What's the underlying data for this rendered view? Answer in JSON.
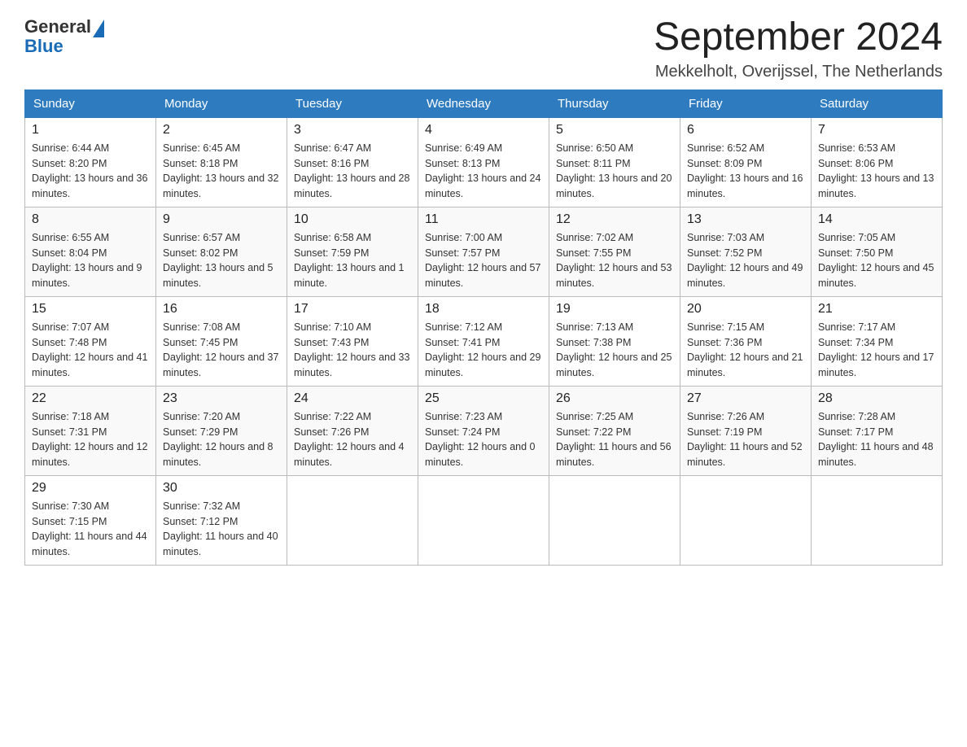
{
  "header": {
    "logo_general": "General",
    "logo_blue": "Blue",
    "title": "September 2024",
    "subtitle": "Mekkelholt, Overijssel, The Netherlands"
  },
  "weekdays": [
    "Sunday",
    "Monday",
    "Tuesday",
    "Wednesday",
    "Thursday",
    "Friday",
    "Saturday"
  ],
  "weeks": [
    [
      {
        "day": "1",
        "sunrise": "6:44 AM",
        "sunset": "8:20 PM",
        "daylight": "13 hours and 36 minutes."
      },
      {
        "day": "2",
        "sunrise": "6:45 AM",
        "sunset": "8:18 PM",
        "daylight": "13 hours and 32 minutes."
      },
      {
        "day": "3",
        "sunrise": "6:47 AM",
        "sunset": "8:16 PM",
        "daylight": "13 hours and 28 minutes."
      },
      {
        "day": "4",
        "sunrise": "6:49 AM",
        "sunset": "8:13 PM",
        "daylight": "13 hours and 24 minutes."
      },
      {
        "day": "5",
        "sunrise": "6:50 AM",
        "sunset": "8:11 PM",
        "daylight": "13 hours and 20 minutes."
      },
      {
        "day": "6",
        "sunrise": "6:52 AM",
        "sunset": "8:09 PM",
        "daylight": "13 hours and 16 minutes."
      },
      {
        "day": "7",
        "sunrise": "6:53 AM",
        "sunset": "8:06 PM",
        "daylight": "13 hours and 13 minutes."
      }
    ],
    [
      {
        "day": "8",
        "sunrise": "6:55 AM",
        "sunset": "8:04 PM",
        "daylight": "13 hours and 9 minutes."
      },
      {
        "day": "9",
        "sunrise": "6:57 AM",
        "sunset": "8:02 PM",
        "daylight": "13 hours and 5 minutes."
      },
      {
        "day": "10",
        "sunrise": "6:58 AM",
        "sunset": "7:59 PM",
        "daylight": "13 hours and 1 minute."
      },
      {
        "day": "11",
        "sunrise": "7:00 AM",
        "sunset": "7:57 PM",
        "daylight": "12 hours and 57 minutes."
      },
      {
        "day": "12",
        "sunrise": "7:02 AM",
        "sunset": "7:55 PM",
        "daylight": "12 hours and 53 minutes."
      },
      {
        "day": "13",
        "sunrise": "7:03 AM",
        "sunset": "7:52 PM",
        "daylight": "12 hours and 49 minutes."
      },
      {
        "day": "14",
        "sunrise": "7:05 AM",
        "sunset": "7:50 PM",
        "daylight": "12 hours and 45 minutes."
      }
    ],
    [
      {
        "day": "15",
        "sunrise": "7:07 AM",
        "sunset": "7:48 PM",
        "daylight": "12 hours and 41 minutes."
      },
      {
        "day": "16",
        "sunrise": "7:08 AM",
        "sunset": "7:45 PM",
        "daylight": "12 hours and 37 minutes."
      },
      {
        "day": "17",
        "sunrise": "7:10 AM",
        "sunset": "7:43 PM",
        "daylight": "12 hours and 33 minutes."
      },
      {
        "day": "18",
        "sunrise": "7:12 AM",
        "sunset": "7:41 PM",
        "daylight": "12 hours and 29 minutes."
      },
      {
        "day": "19",
        "sunrise": "7:13 AM",
        "sunset": "7:38 PM",
        "daylight": "12 hours and 25 minutes."
      },
      {
        "day": "20",
        "sunrise": "7:15 AM",
        "sunset": "7:36 PM",
        "daylight": "12 hours and 21 minutes."
      },
      {
        "day": "21",
        "sunrise": "7:17 AM",
        "sunset": "7:34 PM",
        "daylight": "12 hours and 17 minutes."
      }
    ],
    [
      {
        "day": "22",
        "sunrise": "7:18 AM",
        "sunset": "7:31 PM",
        "daylight": "12 hours and 12 minutes."
      },
      {
        "day": "23",
        "sunrise": "7:20 AM",
        "sunset": "7:29 PM",
        "daylight": "12 hours and 8 minutes."
      },
      {
        "day": "24",
        "sunrise": "7:22 AM",
        "sunset": "7:26 PM",
        "daylight": "12 hours and 4 minutes."
      },
      {
        "day": "25",
        "sunrise": "7:23 AM",
        "sunset": "7:24 PM",
        "daylight": "12 hours and 0 minutes."
      },
      {
        "day": "26",
        "sunrise": "7:25 AM",
        "sunset": "7:22 PM",
        "daylight": "11 hours and 56 minutes."
      },
      {
        "day": "27",
        "sunrise": "7:26 AM",
        "sunset": "7:19 PM",
        "daylight": "11 hours and 52 minutes."
      },
      {
        "day": "28",
        "sunrise": "7:28 AM",
        "sunset": "7:17 PM",
        "daylight": "11 hours and 48 minutes."
      }
    ],
    [
      {
        "day": "29",
        "sunrise": "7:30 AM",
        "sunset": "7:15 PM",
        "daylight": "11 hours and 44 minutes."
      },
      {
        "day": "30",
        "sunrise": "7:32 AM",
        "sunset": "7:12 PM",
        "daylight": "11 hours and 40 minutes."
      },
      null,
      null,
      null,
      null,
      null
    ]
  ]
}
